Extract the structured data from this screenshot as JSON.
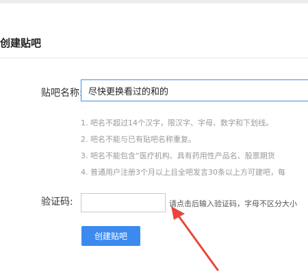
{
  "header": {
    "title": "创建贴吧"
  },
  "form": {
    "name_label": "贴吧名称:",
    "name_value": "尽快更换看过的和的",
    "rules": [
      "1. 吧名不超过14个汉字，限汉字、字母、数字和下划线。",
      "2. 吧名不能与已有贴吧名称重复。",
      "3. 吧名不能包含“医疗机构、具有药用性产品名、股票期货",
      "4. 普通用户注册3个月以上且全吧发言30条以上方可建吧，每"
    ],
    "captcha_label": "验证码:",
    "captcha_value": "",
    "captcha_hint": "请点击后输入验证码，字母不区分大小",
    "submit_label": "创建贴吧"
  },
  "colors": {
    "accent": "#3c8af0",
    "annotation_arrow": "#e8453c"
  }
}
